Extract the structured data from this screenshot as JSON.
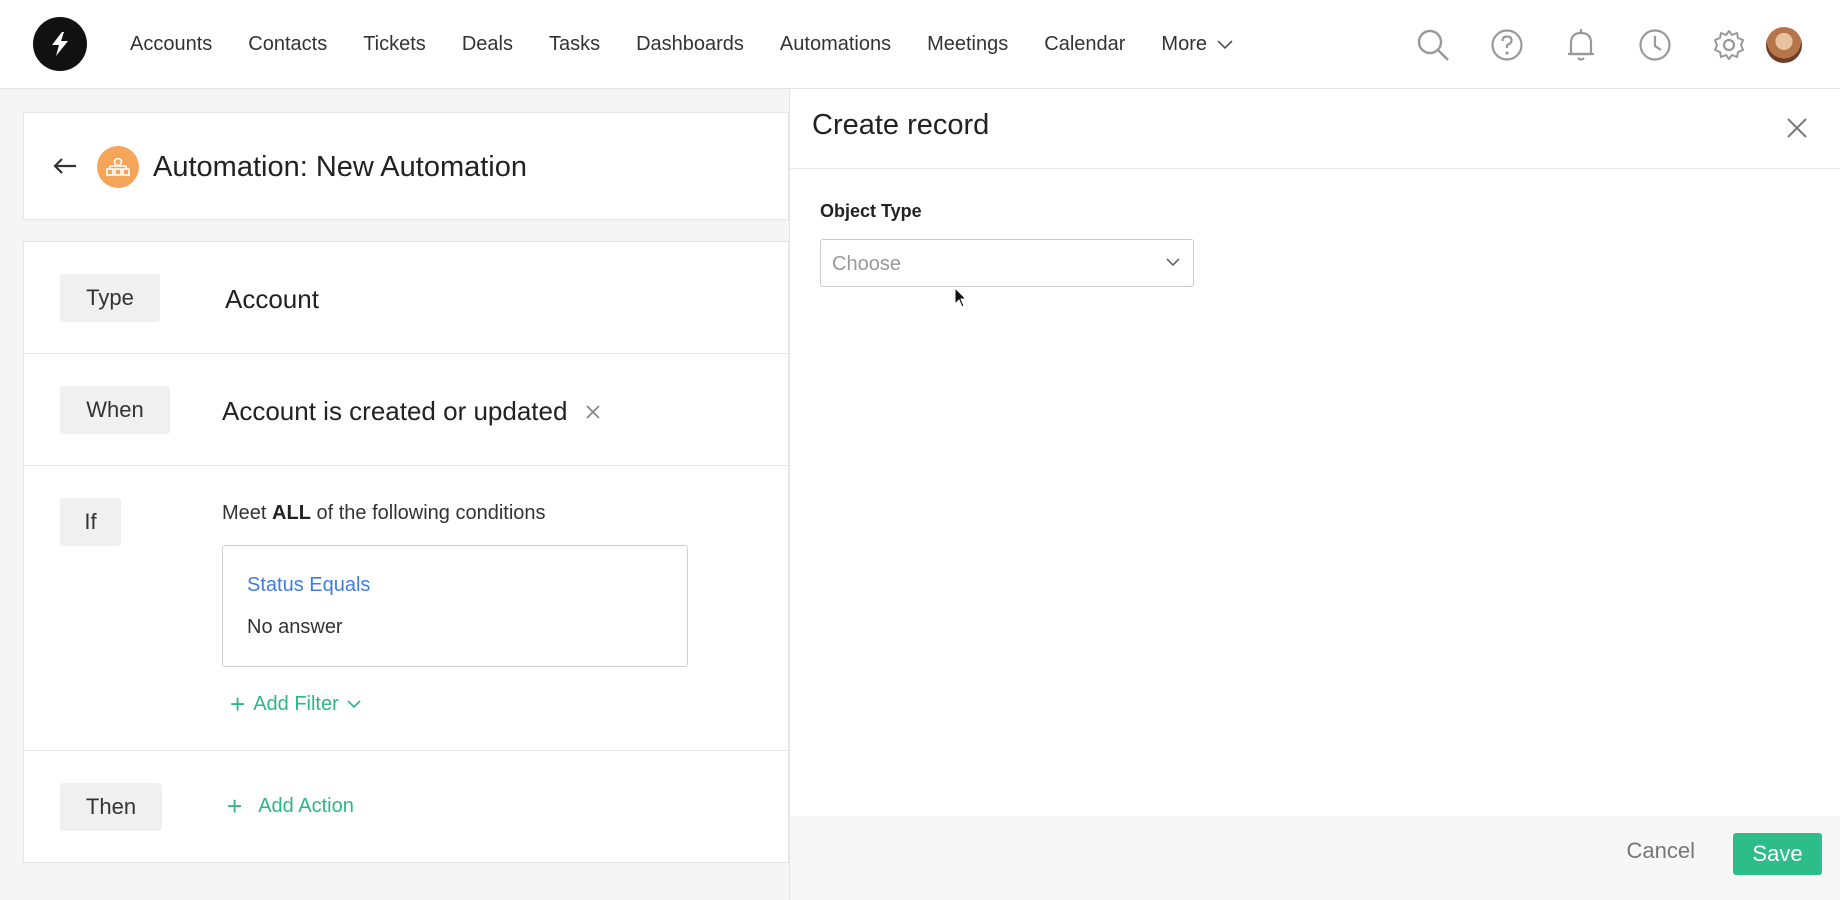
{
  "nav": {
    "items": [
      "Accounts",
      "Contacts",
      "Tickets",
      "Deals",
      "Tasks",
      "Dashboards",
      "Automations",
      "Meetings",
      "Calendar"
    ],
    "more_label": "More"
  },
  "tools": [
    "search-icon",
    "help-icon",
    "bell-icon",
    "clock-icon",
    "gear-icon"
  ],
  "automation": {
    "title": "Automation: New Automation",
    "type_label": "Type",
    "type_value": "Account",
    "when_label": "When",
    "when_value": "Account is created or updated",
    "if_label": "If",
    "if_prefix": "Meet",
    "if_bold": "ALL",
    "if_suffix": "of the following conditions",
    "condition_title": "Status Equals",
    "condition_value": "No answer",
    "add_filter_label": "Add Filter",
    "then_label": "Then",
    "add_action_label": "Add Action"
  },
  "drawer": {
    "title": "Create record",
    "field_label": "Object Type",
    "select_placeholder": "Choose",
    "cancel_label": "Cancel",
    "save_label": "Save"
  },
  "colors": {
    "accent_green": "#2dbd8b",
    "link_blue": "#3f7de0",
    "automation_icon": "#f5a55a"
  }
}
